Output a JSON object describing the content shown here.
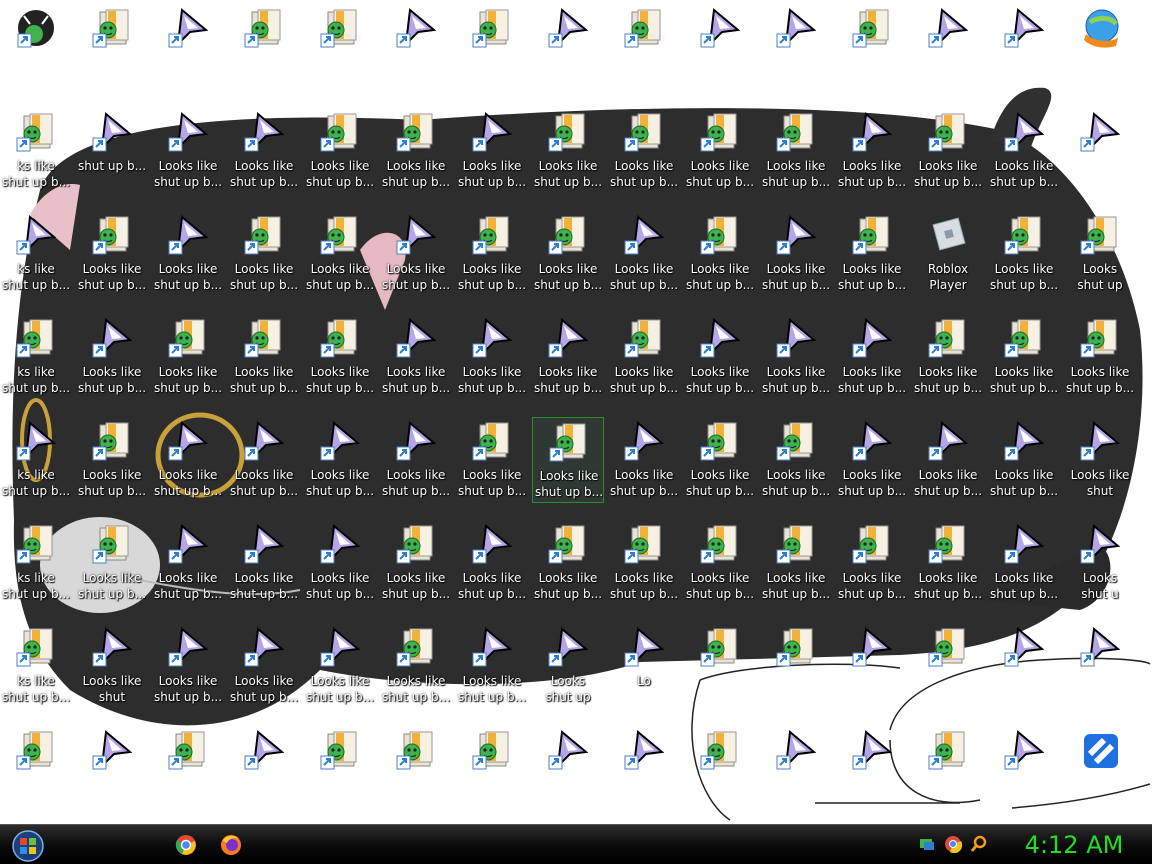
{
  "desktop": {
    "icon_label_default": "Looks like shut up b...",
    "icons": [
      {
        "label": "",
        "kind": "cat-avatar-icon"
      },
      {
        "label": "",
        "kind": "folder-shortcut-icon"
      },
      {
        "label": "",
        "kind": "cursor-shortcut-icon"
      },
      {
        "label": "",
        "kind": "folder-shortcut-icon"
      },
      {
        "label": "",
        "kind": "folder-shortcut-icon"
      },
      {
        "label": "",
        "kind": "cursor-shortcut-icon"
      },
      {
        "label": "",
        "kind": "folder-shortcut-icon"
      },
      {
        "label": "",
        "kind": "cursor-shortcut-icon"
      },
      {
        "label": "",
        "kind": "folder-shortcut-icon"
      },
      {
        "label": "",
        "kind": "cursor-shortcut-icon"
      },
      {
        "label": "",
        "kind": "cursor-shortcut-icon"
      },
      {
        "label": "",
        "kind": "folder-shortcut-icon"
      },
      {
        "label": "",
        "kind": "cursor-shortcut-icon"
      },
      {
        "label": "",
        "kind": "cursor-shortcut-icon"
      },
      {
        "label": "",
        "kind": "download-manager-icon"
      }
    ],
    "roblox_player_label": "Roblox Player",
    "partial_labels": {
      "looks_like": "Looks like",
      "shut_up_b": "shut up b...",
      "looks": "Looks",
      "shut": "shut",
      "shut_up": "shut up",
      "shut_u": "shut u",
      "lo": "Lo",
      "ks_like": "ks like"
    }
  },
  "taskbar": {
    "start": "windows-orb-icon",
    "apps": [
      "chrome-icon",
      "firefox-icon"
    ],
    "tray": [
      "network-icon",
      "chrome-tray-icon",
      "search-tray-icon"
    ],
    "clock": "4:12 AM"
  },
  "colors": {
    "clock": "#22dd22",
    "taskbar": "#111111",
    "label_text": "#ffffff",
    "selection": "#2a8a3a"
  }
}
